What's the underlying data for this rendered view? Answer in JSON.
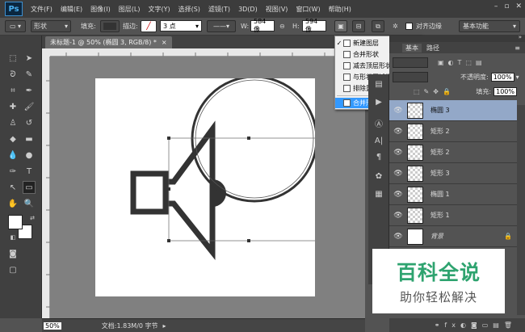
{
  "app": {
    "logo": "Ps"
  },
  "menubar": {
    "items": [
      "文件(F)",
      "编辑(E)",
      "图像(I)",
      "图层(L)",
      "文字(Y)",
      "选择(S)",
      "滤镜(T)",
      "3D(D)",
      "视图(V)",
      "窗口(W)",
      "帮助(H)"
    ]
  },
  "options": {
    "mode": "形状",
    "fill_label": "填充:",
    "stroke_label": "描边:",
    "stroke_width": "3 点",
    "w_label": "W:",
    "w_value": "584 像",
    "h_label": "H:",
    "h_value": "594 像",
    "align_edges": "对齐边缘",
    "workspace": "基本功能"
  },
  "document": {
    "tab_title": "未标题-1 @ 50% (椭圆 3, RGB/8) *",
    "zoom": "50%",
    "doc_info": "文档:1.83M/0 字节"
  },
  "dropdown": {
    "items": [
      {
        "label": "新建图层",
        "checked": true
      },
      {
        "label": "合并形状",
        "checked": false
      },
      {
        "label": "减去顶层形状",
        "checked": false
      },
      {
        "label": "与形状区域相交",
        "checked": false
      },
      {
        "label": "排除重叠形状",
        "checked": false
      },
      {
        "label": "合并形状组件",
        "checked": false
      }
    ]
  },
  "layers_panel": {
    "tab1": "基本",
    "tab2": "路径",
    "opacity_label": "不透明度:",
    "opacity": "100%",
    "fill_label": "填充:",
    "fill": "100%",
    "layers": [
      "椭圆 3",
      "矩形 2",
      "矩形 2",
      "矩形 3",
      "椭圆 1",
      "矩形 1",
      "背景"
    ]
  },
  "watermark": {
    "line1": "百科全说",
    "line2": "助你轻松解决"
  },
  "colors": {
    "accent": "#3399ff",
    "watermark_green": "#2ea36f"
  }
}
